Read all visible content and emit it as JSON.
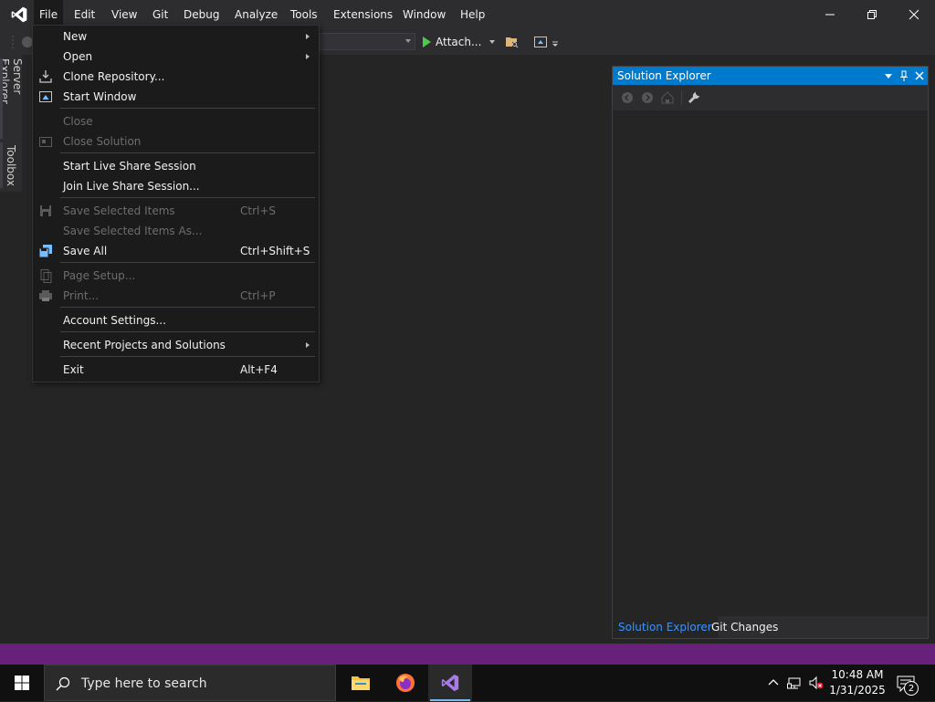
{
  "menubar": {
    "items": [
      "File",
      "Edit",
      "View",
      "Git",
      "Debug",
      "Analyze",
      "Tools",
      "Extensions",
      "Window",
      "Help"
    ],
    "active": "File"
  },
  "toolbar": {
    "attach_label": "Attach..."
  },
  "side_tabs": [
    "Server Explorer",
    "Toolbox"
  ],
  "file_menu": [
    {
      "label": "New",
      "shortcut": "",
      "submenu": true,
      "enabled": true,
      "icon": ""
    },
    {
      "label": "Open",
      "shortcut": "",
      "submenu": true,
      "enabled": true,
      "icon": ""
    },
    {
      "label": "Clone Repository...",
      "shortcut": "",
      "submenu": false,
      "enabled": true,
      "icon": "clone-repository-icon"
    },
    {
      "label": "Start Window",
      "shortcut": "",
      "submenu": false,
      "enabled": true,
      "icon": "start-window-icon"
    },
    {
      "label": "Close",
      "shortcut": "",
      "submenu": false,
      "enabled": false,
      "icon": ""
    },
    {
      "label": "Close Solution",
      "shortcut": "",
      "submenu": false,
      "enabled": false,
      "icon": "close-solution-icon"
    },
    {
      "label": "Start Live Share Session",
      "shortcut": "",
      "submenu": false,
      "enabled": true,
      "icon": ""
    },
    {
      "label": "Join Live Share Session...",
      "shortcut": "",
      "submenu": false,
      "enabled": true,
      "icon": ""
    },
    {
      "label": "Save Selected Items",
      "shortcut": "Ctrl+S",
      "submenu": false,
      "enabled": false,
      "icon": "save-icon"
    },
    {
      "label": "Save Selected Items As...",
      "shortcut": "",
      "submenu": false,
      "enabled": false,
      "icon": ""
    },
    {
      "label": "Save All",
      "shortcut": "Ctrl+Shift+S",
      "submenu": false,
      "enabled": true,
      "icon": "save-all-icon"
    },
    {
      "label": "Page Setup...",
      "shortcut": "",
      "submenu": false,
      "enabled": false,
      "icon": "page-setup-icon"
    },
    {
      "label": "Print...",
      "shortcut": "Ctrl+P",
      "submenu": false,
      "enabled": false,
      "icon": "print-icon"
    },
    {
      "label": "Account Settings...",
      "shortcut": "",
      "submenu": false,
      "enabled": true,
      "icon": ""
    },
    {
      "label": "Recent Projects and Solutions",
      "shortcut": "",
      "submenu": true,
      "enabled": true,
      "icon": ""
    },
    {
      "label": "Exit",
      "shortcut": "Alt+F4",
      "submenu": false,
      "enabled": true,
      "icon": ""
    }
  ],
  "solution_explorer": {
    "title": "Solution Explorer",
    "tabs": [
      "Solution Explorer",
      "Git Changes"
    ],
    "active_tab": "Solution Explorer"
  },
  "taskbar": {
    "search_placeholder": "Type here to search",
    "time": "10:48 AM",
    "date": "1/31/2025",
    "notification_count": "2"
  },
  "colors": {
    "accent": "#007acc",
    "status_bar": "#68217a",
    "menu_bg": "#1b1b1c",
    "window_bg": "#252526",
    "chrome_bg": "#2d2d30"
  }
}
